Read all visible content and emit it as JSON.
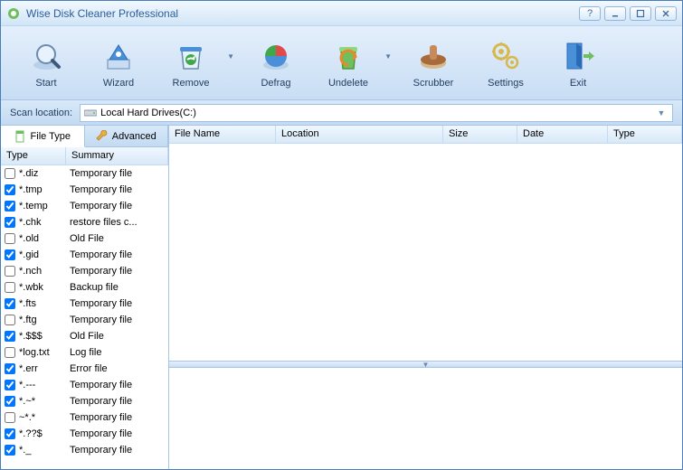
{
  "title": "Wise Disk Cleaner Professional",
  "toolbar": [
    {
      "name": "start",
      "label": "Start",
      "arrow": false
    },
    {
      "name": "wizard",
      "label": "Wizard",
      "arrow": false
    },
    {
      "name": "remove",
      "label": "Remove",
      "arrow": true
    },
    {
      "name": "defrag",
      "label": "Defrag",
      "arrow": false
    },
    {
      "name": "undelete",
      "label": "Undelete",
      "arrow": true
    },
    {
      "name": "scrubber",
      "label": "Scrubber",
      "arrow": false
    },
    {
      "name": "settings",
      "label": "Settings",
      "arrow": false
    },
    {
      "name": "exit",
      "label": "Exit",
      "arrow": false
    }
  ],
  "scan": {
    "label": "Scan location:",
    "selected": "Local Hard Drives(C:)"
  },
  "tabs": {
    "file_type": "File Type",
    "advanced": "Advanced"
  },
  "left_columns": {
    "type": "Type",
    "summary": "Summary"
  },
  "right_columns": {
    "file_name": "File Name",
    "location": "Location",
    "size": "Size",
    "date": "Date",
    "type": "Type"
  },
  "file_types": [
    {
      "checked": false,
      "type": "*.diz",
      "summary": "Temporary file"
    },
    {
      "checked": true,
      "type": "*.tmp",
      "summary": "Temporary file"
    },
    {
      "checked": true,
      "type": "*.temp",
      "summary": "Temporary file"
    },
    {
      "checked": true,
      "type": "*.chk",
      "summary": "restore files c..."
    },
    {
      "checked": false,
      "type": "*.old",
      "summary": "Old File"
    },
    {
      "checked": true,
      "type": "*.gid",
      "summary": "Temporary file"
    },
    {
      "checked": false,
      "type": "*.nch",
      "summary": "Temporary file"
    },
    {
      "checked": false,
      "type": "*.wbk",
      "summary": "Backup file"
    },
    {
      "checked": true,
      "type": "*.fts",
      "summary": "Temporary file"
    },
    {
      "checked": false,
      "type": "*.ftg",
      "summary": "Temporary file"
    },
    {
      "checked": true,
      "type": "*.$$$",
      "summary": "Old File"
    },
    {
      "checked": false,
      "type": "*log.txt",
      "summary": "Log file"
    },
    {
      "checked": true,
      "type": "*.err",
      "summary": "Error file"
    },
    {
      "checked": true,
      "type": "*.---",
      "summary": "Temporary file"
    },
    {
      "checked": true,
      "type": "*.~*",
      "summary": "Temporary file"
    },
    {
      "checked": false,
      "type": "~*.*",
      "summary": "Temporary file"
    },
    {
      "checked": true,
      "type": "*.??$",
      "summary": "Temporary file"
    },
    {
      "checked": true,
      "type": "*._",
      "summary": "Temporary file"
    }
  ]
}
